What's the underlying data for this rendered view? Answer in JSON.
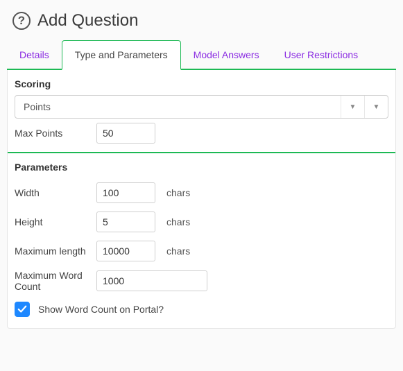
{
  "header": {
    "title": "Add Question"
  },
  "tabs": {
    "details": "Details",
    "type_params": "Type and Parameters",
    "model_answers": "Model Answers",
    "user_restrictions": "User Restrictions"
  },
  "scoring": {
    "section_title": "Scoring",
    "select_value": "Points",
    "max_points_label": "Max Points",
    "max_points_value": "50"
  },
  "parameters": {
    "section_title": "Parameters",
    "width_label": "Width",
    "width_value": "100",
    "width_unit": "chars",
    "height_label": "Height",
    "height_value": "5",
    "height_unit": "chars",
    "maxlen_label": "Maximum length",
    "maxlen_value": "10000",
    "maxlen_unit": "chars",
    "maxword_label": "Maximum Word Count",
    "maxword_value": "1000",
    "show_wc_label": "Show Word Count on Portal?",
    "show_wc_checked": true
  }
}
